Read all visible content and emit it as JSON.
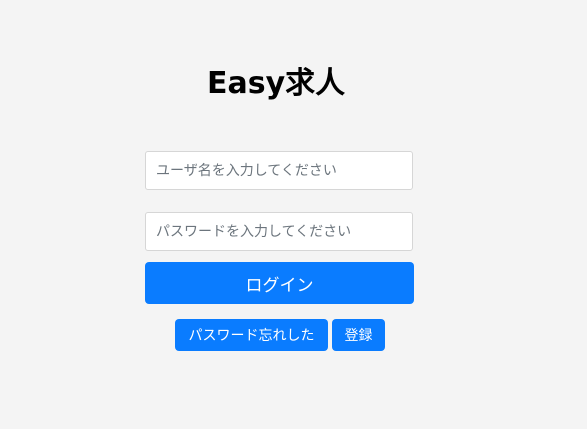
{
  "logo": {
    "text": "Easy求人"
  },
  "login_form": {
    "username_placeholder": "ユーザ名を入力してください",
    "password_placeholder": "パスワードを入力してください",
    "login_label": "ログイン",
    "forgot_password_label": "パスワード忘れした",
    "register_label": "登録"
  },
  "colors": {
    "background": "#f4f4f4",
    "primary_button": "#0a7cff"
  }
}
